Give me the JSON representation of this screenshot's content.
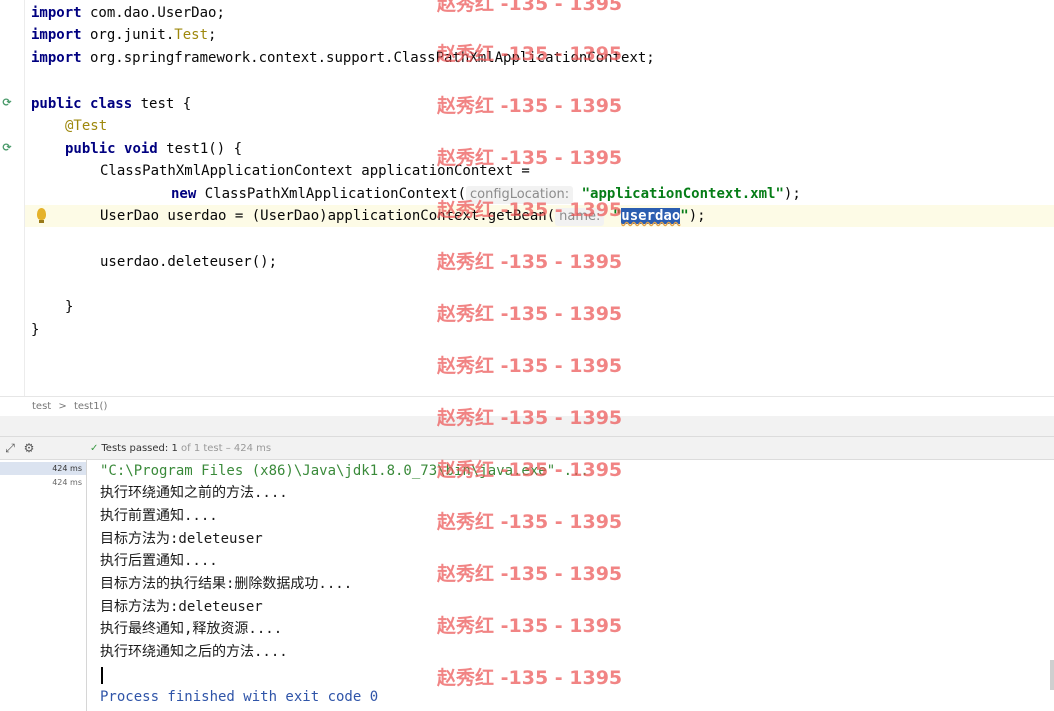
{
  "editor": {
    "lines": [
      {
        "kw": "import",
        "rest": " com.dao.UserDao;"
      },
      {
        "kw": "import",
        "pre": " org.junit.",
        "ann": "Test",
        "post": ";"
      },
      {
        "kw": "import",
        "rest": " org.springframework.context.support.ClassPathXmlApplicationContext;"
      },
      {
        "kw1": "public",
        "kw2": "class",
        "rest": " test {"
      },
      {
        "ann": "@Test"
      },
      {
        "kw1": "public",
        "kw2": "void",
        "rest": " test1() {"
      },
      {
        "text": "ClassPathXmlApplicationContext applicationContext ="
      },
      {
        "kw": "new",
        "pre": " ClassPathXmlApplicationContext(",
        "hint": "configLocation:",
        "str": "\"applicationContext.xml\"",
        "post": ");"
      },
      {
        "pre": "UserDao userdao = (UserDao)applicationContext.getBean(",
        "hint": "name:",
        "str_open": "\"",
        "sel": "userdao",
        "str_close": "\"",
        "post": ");"
      },
      {
        "text": "userdao.deleteuser();"
      },
      {
        "text": "}"
      },
      {
        "text": "}"
      }
    ]
  },
  "breadcrumb": {
    "items": [
      "test",
      "test1()"
    ],
    "separator": ">"
  },
  "run": {
    "status_prefix": "Tests passed:",
    "status_count": "1",
    "status_suffix": "of 1 test – 424 ms",
    "tree_times": [
      "424 ms",
      "424 ms"
    ]
  },
  "console": {
    "lines": [
      "\"C:\\Program Files (x86)\\Java\\jdk1.8.0_73\\bin\\java.exe\" ...",
      "执行环绕通知之前的方法....",
      "执行前置通知....",
      "目标方法为:deleteuser",
      "执行后置通知....",
      "目标方法的执行结果:删除数据成功....",
      "目标方法为:deleteuser",
      "执行最终通知,释放资源....",
      "执行环绕通知之后的方法....",
      "",
      "Process finished with exit code 0"
    ]
  },
  "watermark": {
    "text": "赵秀红 -135 - 1395",
    "color": "#eb5555"
  },
  "colors": {
    "keyword": "#0033b3",
    "annotation": "#9e880d",
    "string": "#067d17",
    "selection": "#2a5db0",
    "finish": "#2f54a8"
  }
}
